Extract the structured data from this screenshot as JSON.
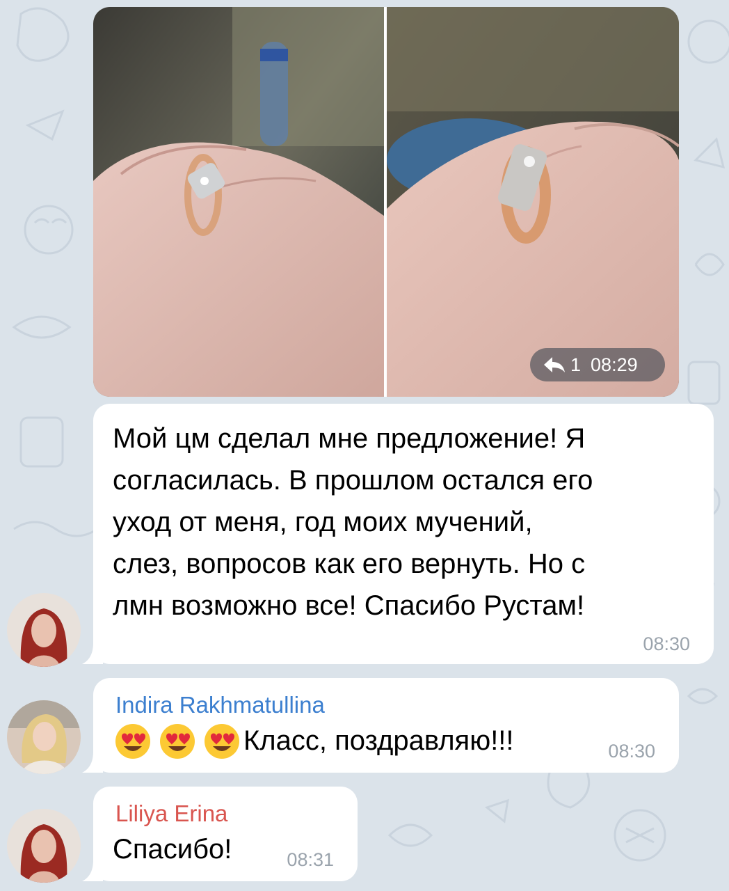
{
  "photo_album": {
    "forward_count": "1",
    "time": "08:29",
    "forward_icon": "forward-arrow-icon"
  },
  "messages": [
    {
      "lines": [
        "Мой цм сделал мне предложение! Я",
        "согласилась. В прошлом остался его",
        "уход от меня, год моих мучений,",
        "слез, вопросов как его вернуть. Но с",
        "лмн возможно все! Спасибо Рустам!"
      ],
      "time": "08:30"
    },
    {
      "sender": "Indira Rakhmatullina",
      "sender_color": "#3c7fcf",
      "emoji": [
        "heart-eyes-emoji",
        "heart-eyes-emoji",
        "heart-eyes-emoji"
      ],
      "text": "Класс, поздравляю!!!",
      "time": "08:30"
    },
    {
      "sender": "Liliya Erina",
      "sender_color": "#d9554f",
      "text": "Спасибо!",
      "time": "08:31"
    }
  ],
  "colors": {
    "background": "#dbe3ea",
    "bubble": "#ffffff",
    "time": "#9aa3ac"
  }
}
